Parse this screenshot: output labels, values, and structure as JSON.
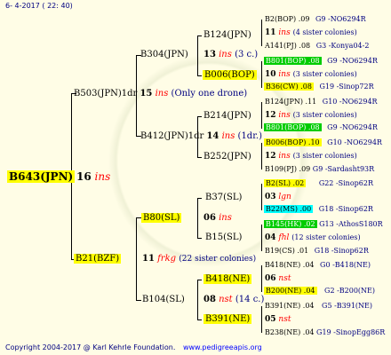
{
  "header": {
    "date": "6- 4-2017 ( 22: 40)"
  },
  "footer": {
    "copyright": "Copyright 2004-2017 @ Karl Kehrle Foundation.",
    "url": "www.pedigreeapis.org"
  },
  "root": {
    "label": "B643(JPN)",
    "num": "16",
    "ins": "ins"
  },
  "gen1": {
    "top": {
      "label": "B503(JPN)1dr",
      "num": "15",
      "ins": "ins",
      "note": "(Only one drone)"
    },
    "bottom": {
      "label": "B21(BZF)",
      "num": "11",
      "ins": "frkg",
      "note": "(22 sister colonies)"
    }
  },
  "gen2": {
    "a": {
      "label": "B304(JPN)"
    },
    "b": {
      "label": "B412(JPN)1dr",
      "num": "14",
      "ins": "ins",
      "note": "(1dr.)"
    },
    "c": {
      "label": "B80(SL)",
      "num": "06",
      "ins": "ins"
    },
    "d": {
      "label": "B104(SL)",
      "num": "08",
      "ins": "nst",
      "note": "(14 c.)"
    }
  },
  "gen2a": {
    "num": "13",
    "ins": "ins",
    "note": "(3 c.)"
  },
  "gen3": {
    "a": {
      "label": "B124(JPN)"
    },
    "b": {
      "label": "B006(BOP)"
    },
    "c": {
      "label": "B214(JPN)"
    },
    "d": {
      "label": "B252(JPN)"
    },
    "e": {
      "label": "B37(SL)"
    },
    "f": {
      "label": "B15(SL)"
    },
    "g": {
      "label": "B418(NE)"
    },
    "h": {
      "label": "B391(NE)"
    }
  },
  "gen4": [
    {
      "label": "B2(BOP) .09",
      "info": "G9 -NO6294R"
    },
    {
      "label": "11",
      "ins": "ins",
      "note": "(4 sister colonies)"
    },
    {
      "label": "A141(PJ) .08",
      "info": "G3 -Konya04-2"
    },
    {
      "label": "B801(BOP) .08",
      "info": "G9 -NO6294R"
    },
    {
      "label": "10",
      "ins": "ins",
      "note": "(3 sister colonies)"
    },
    {
      "label": "B36(CW) .08",
      "info": "G19 -Sinop72R"
    },
    {
      "label": "B124(JPN) .11",
      "info": "G10 -NO6294R"
    },
    {
      "label": "12",
      "ins": "ins",
      "note": "(3 sister colonies)"
    },
    {
      "label": "B801(BOP) .08",
      "info": "G9 -NO6294R"
    },
    {
      "label": "B006(BOP) .10",
      "info": "G10 -NO6294R"
    },
    {
      "label": "12",
      "ins": "ins",
      "note": "(3 sister colonies)"
    },
    {
      "label": "B109(PJ) .09",
      "info": "G9 -Sardasht93R"
    },
    {
      "label": "B2(SL) .02",
      "info": "G22 -Sinop62R"
    },
    {
      "label": "03",
      "ins": "lgn"
    },
    {
      "label": "B22(MS) .00",
      "info": "G18 -Sinop62R"
    },
    {
      "label": "B145(HK) .02",
      "info": "G13 -AthosS180R"
    },
    {
      "label": "04",
      "ins": "fhl",
      "note": "(12 sister colonies)"
    },
    {
      "label": "B19(CS) .01",
      "info": "G18 -Sinop62R"
    },
    {
      "label": "B418(NE) .04",
      "info": "G0 -B418(NE)"
    },
    {
      "label": "06",
      "ins": "nst"
    },
    {
      "label": "B200(NE) .04",
      "info": "G2 -B200(NE)"
    },
    {
      "label": "B391(NE) .04",
      "info": "G5 -B391(NE)"
    },
    {
      "label": "05",
      "ins": "nst"
    },
    {
      "label": "B238(NE) .04",
      "info": "G19 -SinopEgg86R"
    }
  ]
}
